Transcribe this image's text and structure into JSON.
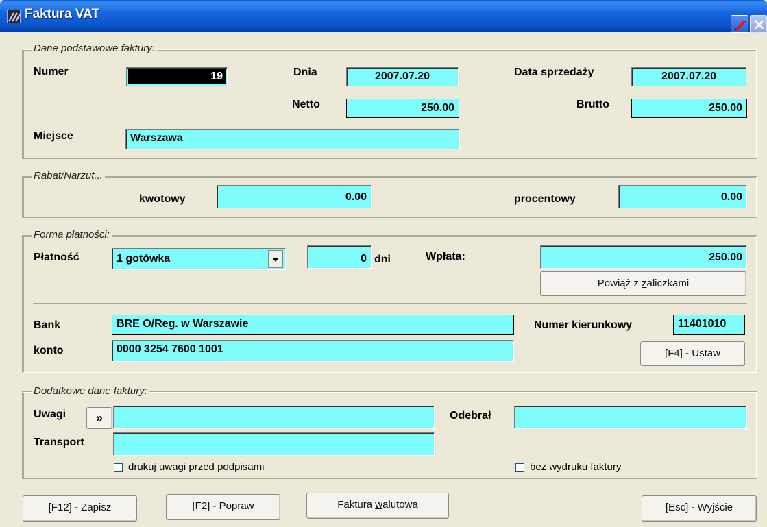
{
  "window": {
    "title": "Faktura VAT"
  },
  "basic": {
    "group_title": "Dane podstawowe faktury:",
    "numer_label": "Numer",
    "numer_value": "19",
    "dnia_label": "Dnia",
    "dnia_value": "2007.07.20",
    "data_sprzedazy_label": "Data sprzedaży",
    "data_sprzedazy_value": "2007.07.20",
    "netto_label": "Netto",
    "netto_value": "250.00",
    "brutto_label": "Brutto",
    "brutto_value": "250.00",
    "miejsce_label": "Miejsce",
    "miejsce_value": "Warszawa"
  },
  "rabat": {
    "group_title": "Rabat/Narzut...",
    "kwotowy_label": "kwotowy",
    "kwotowy_value": "0.00",
    "procentowy_label": "procentowy",
    "procentowy_value": "0.00"
  },
  "payment": {
    "group_title": "Forma płatności:",
    "platnosc_label": "Płatność",
    "platnosc_value": "1 gotówka",
    "days_value": "0",
    "days_label": "dni",
    "wplata_label": "Wpłata:",
    "wplata_value": "250.00",
    "powiaz_prefix": "Powiąż z ",
    "powiaz_key": "z",
    "powiaz_suffix": "aliczkami",
    "bank_label": "Bank",
    "bank_value": "BRE O/Reg. w Warszawie",
    "numer_kier_label": "Numer kierunkowy",
    "numer_kier_value": "11401010",
    "konto_label": "konto",
    "konto_value": "0000 3254 7600 1001",
    "ustaw_button": "[F4] - Ustaw"
  },
  "extra": {
    "group_title": "Dodatkowe dane faktury:",
    "uwagi_label": "Uwagi",
    "uwagi_button": "»",
    "uwagi_value": "",
    "odebral_label": "Odebrał",
    "odebral_value": "",
    "transport_label": "Transport",
    "transport_value": "",
    "drukuj_label": "drukuj uwagi przed podpisami",
    "drukuj_checked": false,
    "bez_wydruku_label": "bez wydruku faktury",
    "bez_wydruku_checked": false
  },
  "footer": {
    "zapisz": "[F12] - Zapisz",
    "popraw": "[F2] - Popraw",
    "walutowa_prefix": "Faktura ",
    "walutowa_key": "w",
    "walutowa_suffix": "alutowa",
    "wyjscie": "[Esc] - Wyjście"
  },
  "colors": {
    "field_bg": "#7ffcfc",
    "window_bg": "#ece9d8",
    "titlebar": "#0a52c8"
  }
}
